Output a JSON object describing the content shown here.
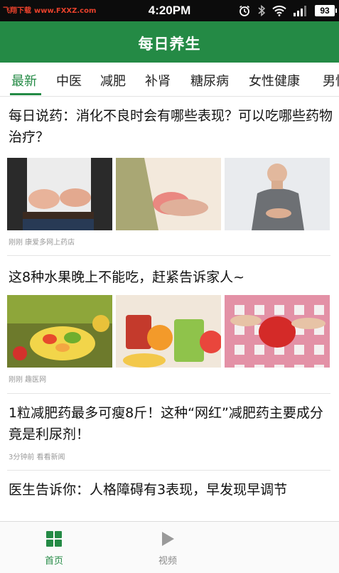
{
  "status_bar": {
    "watermark": "飞翔下载",
    "watermark_url": "www.FXXZ.com",
    "time": "4:20PM",
    "battery": "93",
    "icons": [
      "alarm-icon",
      "bluetooth-icon",
      "wifi-icon",
      "signal-icon",
      "battery-icon"
    ]
  },
  "header": {
    "title": "每日养生"
  },
  "tabs": [
    {
      "label": "最新",
      "active": true
    },
    {
      "label": "中医"
    },
    {
      "label": "减肥"
    },
    {
      "label": "补肾"
    },
    {
      "label": "糖尿病"
    },
    {
      "label": "女性健康"
    },
    {
      "label": "男性"
    }
  ],
  "articles": [
    {
      "title": "每日说药：消化不良时会有哪些表现？可以吃哪些药物治疗？",
      "meta": "刚刚 康爱多网上药店"
    },
    {
      "title": "这8种水果晚上不能吃，赶紧告诉家人~",
      "meta": "刚刚 趣医网"
    },
    {
      "title": "1粒减肥药最多可瘦8斤！这种“网红”减肥药主要成分竟是利尿剂！",
      "meta": "3分钟前 看看新闻"
    },
    {
      "title": "医生告诉你：人格障碍有3表现，早发现早调节"
    }
  ],
  "bottom_nav": [
    {
      "label": "首页",
      "icon": "grid-icon",
      "active": true
    },
    {
      "label": "视频",
      "icon": "play-icon"
    }
  ],
  "colors": {
    "brand_green": "#248a45",
    "status_bar_bg": "#0c0c0c"
  }
}
